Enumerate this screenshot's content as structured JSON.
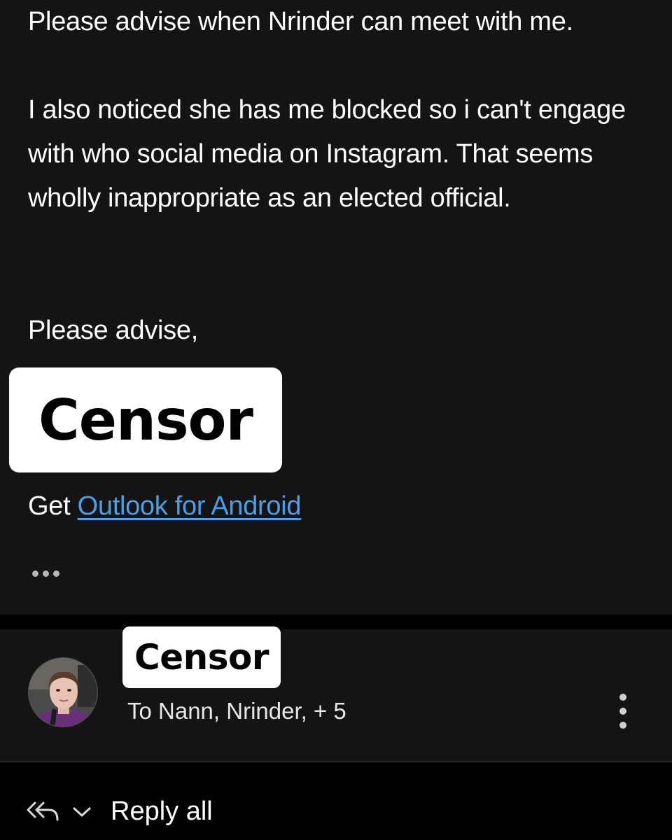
{
  "message": {
    "paragraph_1": "Please advise when Nrinder can meet with me.",
    "paragraph_2": "I also noticed she has me blocked so i can't engage with who social media on Instagram. That seems wholly inappropriate as an elected official.",
    "paragraph_3": "Please advise,",
    "signature_redaction": "Censor",
    "get_prefix": "Get ",
    "outlook_link": "Outlook for Android",
    "more_icon": "ellipsis-icon"
  },
  "next_message": {
    "sender_redaction": "Censor",
    "recipients": "To Nann, Nrinder, + 5",
    "avatar_icon": "avatar",
    "menu_icon": "vertical-ellipsis-icon"
  },
  "reply_bar": {
    "reply_icon": "reply-all-icon",
    "chevron_icon": "chevron-down-icon",
    "label": "Reply all"
  },
  "colors": {
    "background": "#141414",
    "divider": "#000000",
    "link": "#4a9fe8",
    "redaction_box": "#ffffff"
  }
}
